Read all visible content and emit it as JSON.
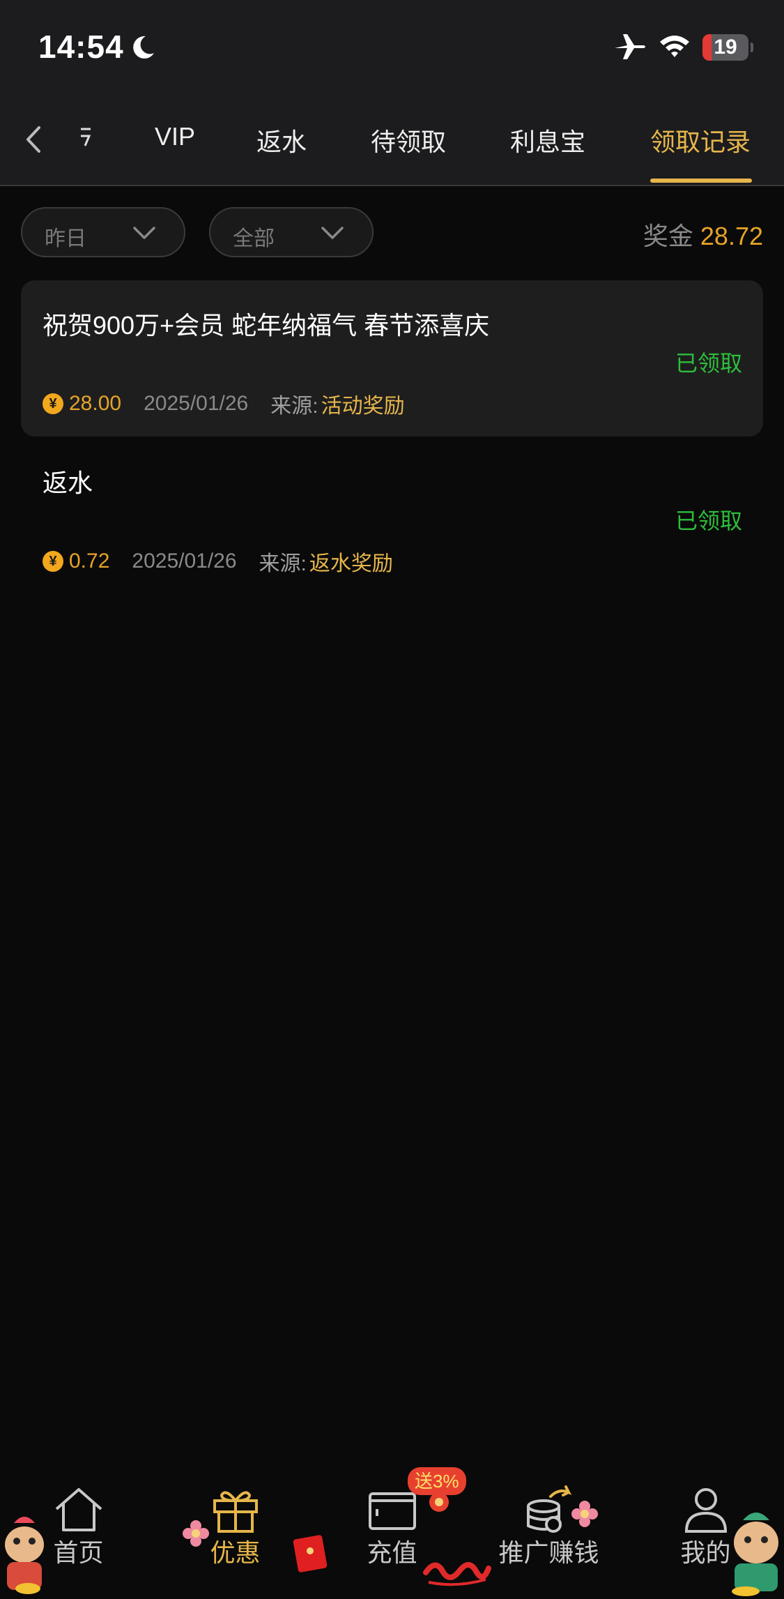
{
  "status_bar": {
    "time": "14:54",
    "battery": "19",
    "battery_level": 0.19
  },
  "tabs": [
    {
      "label": "VIP"
    },
    {
      "label": "返水"
    },
    {
      "label": "待领取"
    },
    {
      "label": "利息宝"
    },
    {
      "label": "领取记录",
      "active": true
    }
  ],
  "filters": {
    "date": "昨日",
    "type": "全部"
  },
  "prize": {
    "label": "奖金",
    "value": "28.72"
  },
  "records": [
    {
      "title": "祝贺900万+会员 蛇年纳福气 春节添喜庆",
      "status": "已领取",
      "coin_symbol": "¥",
      "amount": "28.00",
      "date": "2025/01/26",
      "source_label": "来源:",
      "source": "活动奖励"
    },
    {
      "title": "返水",
      "status": "已领取",
      "coin_symbol": "¥",
      "amount": "0.72",
      "date": "2025/01/26",
      "source_label": "来源:",
      "source": "返水奖励"
    }
  ],
  "bottom_nav": [
    {
      "label": "首页",
      "icon": "home-icon"
    },
    {
      "label": "优惠",
      "icon": "gift-icon",
      "active": true
    },
    {
      "label": "充值",
      "icon": "wallet-icon",
      "badge": "送3%"
    },
    {
      "label": "推广赚钱",
      "icon": "coins-share-icon"
    },
    {
      "label": "我的",
      "icon": "user-icon"
    }
  ],
  "colors": {
    "accent": "#e6b64a",
    "amount": "#e6a428",
    "success": "#2dbe3a",
    "badge": "#e8402f"
  }
}
